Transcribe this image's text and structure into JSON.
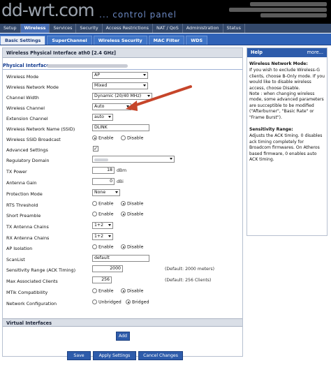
{
  "header": {
    "logo": "dd-wrt.com",
    "subtitle": "... control panel"
  },
  "tabs": [
    "Setup",
    "Wireless",
    "Services",
    "Security",
    "Access Restrictions",
    "NAT / QoS",
    "Administration",
    "Status"
  ],
  "subtabs": [
    "Basic Settings",
    "SuperChannel",
    "Wireless Security",
    "MAC Filter",
    "WDS"
  ],
  "main": {
    "section_title": "Wireless Physical Interface ath0 [2.4 GHz]",
    "physical_label": "Physical Interface",
    "fields": {
      "wireless_mode": {
        "label": "Wireless Mode",
        "value": "AP"
      },
      "network_mode": {
        "label": "Wireless Network Mode",
        "value": "Mixed"
      },
      "channel_width": {
        "label": "Channel Width",
        "value": "Dynamic (20/40 MHz)"
      },
      "wireless_channel": {
        "label": "Wireless Channel",
        "value": "Auto"
      },
      "extension_channel": {
        "label": "Extension Channel",
        "value": "auto"
      },
      "ssid": {
        "label": "Wireless Network Name (SSID)",
        "value": "DLINK"
      },
      "ssid_broadcast": {
        "label": "Wireless SSID Broadcast",
        "opt1": "Enable",
        "opt2": "Disable"
      },
      "advanced": {
        "label": "Advanced Settings",
        "mark": "✓"
      },
      "regulatory": {
        "label": "Regulatory Domain"
      },
      "tx_power": {
        "label": "TX Power",
        "value": "18",
        "unit": "dBm"
      },
      "antenna_gain": {
        "label": "Antenna Gain",
        "value": "0",
        "unit": "dBi"
      },
      "protection_mode": {
        "label": "Protection Mode",
        "value": "None"
      },
      "rts_threshold": {
        "label": "RTS Threshold",
        "opt1": "Enable",
        "opt2": "Disable"
      },
      "short_preamble": {
        "label": "Short Preamble",
        "opt1": "Enable",
        "opt2": "Disable"
      },
      "tx_chains": {
        "label": "TX Antenna Chains",
        "value": "1+2"
      },
      "rx_chains": {
        "label": "RX Antenna Chains",
        "value": "1+2"
      },
      "ap_isolation": {
        "label": "AP Isolation",
        "opt1": "Enable",
        "opt2": "Disable"
      },
      "scanlist": {
        "label": "ScanList",
        "value": "default"
      },
      "sensitivity": {
        "label": "Sensitivity Range (ACK Timing)",
        "value": "2000",
        "hint": "(Default: 2000 meters)"
      },
      "max_clients": {
        "label": "Max Associated Clients",
        "value": "256",
        "hint": "(Default: 256 Clients)"
      },
      "mtik": {
        "label": "MTik Compatibility",
        "opt1": "Enable",
        "opt2": "Disable"
      },
      "net_config": {
        "label": "Network Configuration",
        "opt1": "Unbridged",
        "opt2": "Bridged"
      }
    },
    "virtual_title": "Virtual Interfaces",
    "add_label": "Add",
    "save_label": "Save",
    "apply_label": "Apply Settings",
    "cancel_label": "Cancel Changes"
  },
  "help": {
    "title": "Help",
    "more": "more...",
    "h1": "Wireless Network Mode:",
    "p1": "If you wish to exclude Wireless-G clients, choose B-Only mode. If you would like to disable wireless access, choose Disable.",
    "p2": "Note : when changing wireless mode, some advanced parameters are succeptible to be modified (\"Afterburner\", \"Basic Rate\" or \"Frame Burst\").",
    "h2": "Sensitivity Range:",
    "p3": "Adjusts the ACK timing. 0 disables ack timing completely for Broadcom firmwares. On Atheros based firmware, 0 enables auto ACK timing."
  },
  "colors": {
    "accent": "#2e5cab",
    "tabbar": "#33486a",
    "arrow": "#c6452a"
  }
}
